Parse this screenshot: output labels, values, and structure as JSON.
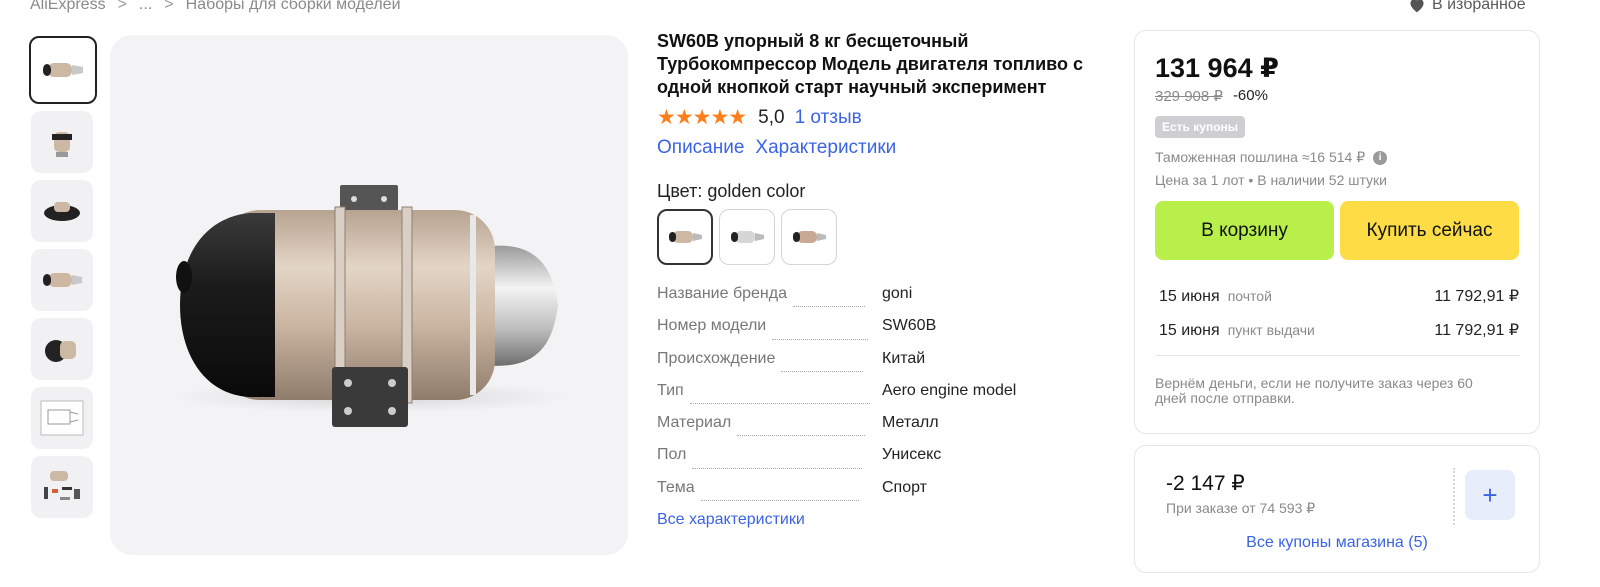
{
  "breadcrumb": {
    "items": [
      "AliExpress",
      "...",
      "Наборы для сборки моделей"
    ],
    "separator": ">"
  },
  "favorites": {
    "label": "В избранное",
    "icon": "heart-icon"
  },
  "gallery": {
    "thumbnail_count": 7,
    "active_index": 0
  },
  "product": {
    "title": "SW60B упорный 8 кг бесщеточный Турбокомпрессор Модель двигателя топливо с одной кнопкой старт научный эксперимент",
    "stars": "★★★★★",
    "rating": "5,0",
    "reviews": "1 отзыв",
    "links": {
      "description": "Описание",
      "characteristics": "Характеристики"
    },
    "color_label": "Цвет: golden color",
    "color_option_count": 3,
    "specs": [
      {
        "key": "Название бренда",
        "value": "goni"
      },
      {
        "key": "Номер модели",
        "value": "SW60B"
      },
      {
        "key": "Происхождение",
        "value": "Китай"
      },
      {
        "key": "Тип",
        "value": "Aero engine model"
      },
      {
        "key": "Материал",
        "value": "Металл"
      },
      {
        "key": "Пол",
        "value": "Унисекс"
      },
      {
        "key": "Тема",
        "value": "Спорт"
      }
    ],
    "all_specs_link": "Все характеристики"
  },
  "buybox": {
    "price": "131 964 ₽",
    "old_price": "329 908 ₽",
    "discount": "-60%",
    "coupon_badge": "Есть купоны",
    "duty": "Таможенная пошлина ≈16 514 ₽",
    "stock": "Цена за 1 лот • В наличии 52 штуки",
    "add_to_cart": "В корзину",
    "buy_now": "Купить сейчас",
    "shipping": [
      {
        "date": "15 июня",
        "method": "почтой",
        "amount": "11 792,91 ₽"
      },
      {
        "date": "15 июня",
        "method": "пункт выдачи",
        "amount": "11 792,91 ₽"
      }
    ],
    "refund_note": "Вернём деньги, если не получите заказ через 60 дней после отправки."
  },
  "coupons": {
    "amount": "-2 147 ₽",
    "condition": "При заказе от 74 593 ₽",
    "add_label": "+",
    "all_link": "Все купоны магазина (5)"
  },
  "colors": {
    "link": "#3b63e6",
    "star": "#fd7e1b",
    "cart_btn": "#b9ef4a",
    "buy_btn": "#fddc45"
  }
}
